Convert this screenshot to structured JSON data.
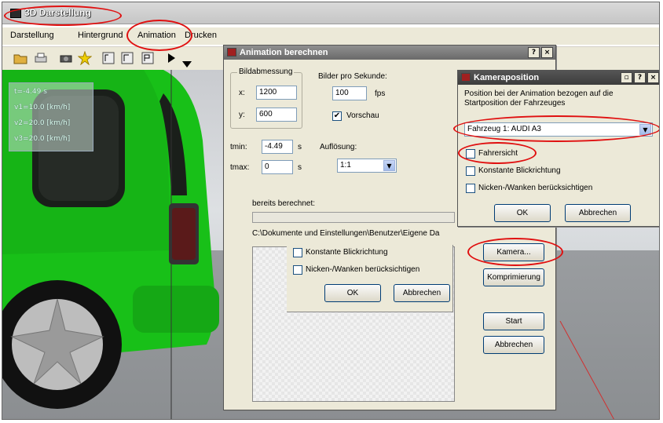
{
  "window": {
    "title": "3D Darstellung"
  },
  "menu": [
    "Darstellung",
    "Hintergrund",
    "Animation",
    "Drucken"
  ],
  "toolbar_icons": [
    "open-folder-icon",
    "print-icon",
    "camera-icon",
    "star-icon",
    "view-a-icon",
    "view-b-icon",
    "view-c-icon",
    "play-icon",
    "dropdown-icon"
  ],
  "overlay": {
    "rows": [
      "t=-4.49 s",
      "v1=10.0 [km/h]",
      "v2=20.0 [km/h]",
      "v3=20.0 [km/h]"
    ]
  },
  "animation_dialog": {
    "title": "Animation berechnen",
    "group_size": "Bildabmessung",
    "x_label": "x:",
    "x_value": "1200",
    "y_label": "y:",
    "y_value": "600",
    "fps_label": "Bilder pro Sekunde:",
    "fps_value": "100",
    "fps_unit": "fps",
    "preview_label": "Vorschau",
    "tmin_label": "tmin:",
    "tmin_value": "-4.49",
    "tmin_unit": "s",
    "tmax_label": "tmax:",
    "tmax_value": "0",
    "tmax_unit": "s",
    "resolution_label": "Auflösung:",
    "resolution_value": "1:1",
    "progress_label": "bereits berechnet:",
    "path_text": "C:\\Dokumente und Einstellungen\\Benutzer\\Eigene Da",
    "camera_button": "Kamera...",
    "compression_button": "Komprimierung",
    "start_button": "Start",
    "cancel_button": "Abbrechen",
    "ghost_check1": "Konstante Blickrichtung",
    "ghost_check2": "Nicken-/Wanken berücksichtigen",
    "ghost_ok": "OK",
    "ghost_cancel": "Abbrechen"
  },
  "camera_dialog": {
    "title": "Kameraposition",
    "description": "Position bei der Animation bezogen auf die Startposition der Fahrzeuges",
    "vehicle_value": "Fahrzeug 1: AUDI A3",
    "check_driver_view": "Fahrersicht",
    "check_constant_view": "Konstante Blickrichtung",
    "check_pitch_roll": "Nicken-/Wanken berücksichtigen",
    "ok_button": "OK",
    "cancel_button": "Abbrechen"
  },
  "colors": {
    "annotation": "#e01010",
    "car": "#18c018",
    "titlebar": "#6a6a6a"
  }
}
